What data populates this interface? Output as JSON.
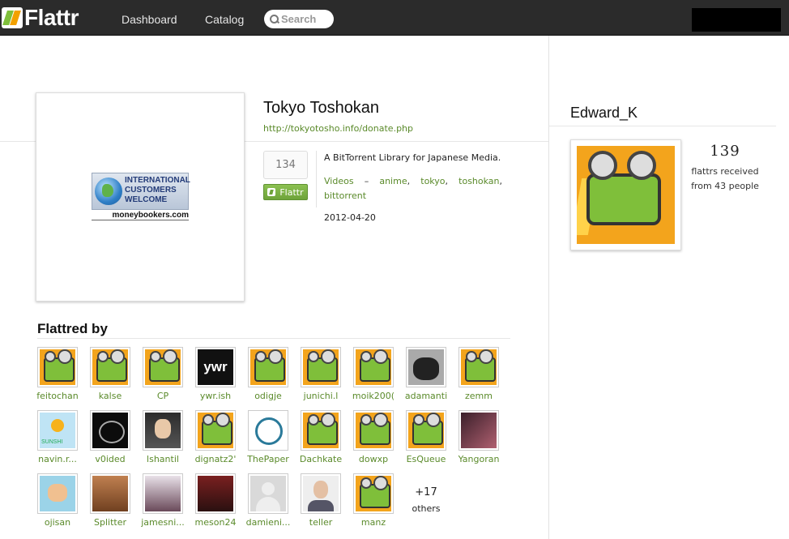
{
  "header": {
    "logo_text": "Flattr",
    "nav": {
      "dashboard": "Dashboard",
      "catalog": "Catalog"
    },
    "search_placeholder": "Search"
  },
  "thing": {
    "title": "Tokyo Toshokan",
    "url": "http://tokyotosho.info/donate.php",
    "flattr_count": "134",
    "flattr_button": "Flattr",
    "description": "A BitTorrent Library for Japanese Media.",
    "category": "Videos",
    "tag_separator": "–",
    "tags": [
      "anime",
      "tokyo",
      "toshokan",
      "bittorrent"
    ],
    "date": "2012-04-20",
    "image": {
      "banner_lines": [
        "INTERNATIONAL",
        "CUSTOMERS",
        "WELCOME"
      ],
      "domain": "moneybookers.com"
    }
  },
  "flattred_by": {
    "heading": "Flattred by",
    "users": [
      {
        "name": "feitochan",
        "avatar": "projector"
      },
      {
        "name": "kalse",
        "avatar": "projector"
      },
      {
        "name": "CP",
        "avatar": "projector"
      },
      {
        "name": "ywr.ish",
        "avatar": "dark",
        "avatar_text": "ywr"
      },
      {
        "name": "odigje",
        "avatar": "projector"
      },
      {
        "name": "junichi.l",
        "avatar": "projector"
      },
      {
        "name": "moik200(",
        "avatar": "projector"
      },
      {
        "name": "adamanti",
        "avatar": "adam"
      },
      {
        "name": "zemm",
        "avatar": "projector"
      },
      {
        "name": "navin.r...",
        "avatar": "sun"
      },
      {
        "name": "v0ided",
        "avatar": "v0"
      },
      {
        "name": "lshantil",
        "avatar": "portrait2"
      },
      {
        "name": "dignatz2'",
        "avatar": "projector"
      },
      {
        "name": "ThePaper",
        "avatar": "logo"
      },
      {
        "name": "Dachkate",
        "avatar": "projector"
      },
      {
        "name": "dowxp",
        "avatar": "projector"
      },
      {
        "name": "EsQueue",
        "avatar": "projector"
      },
      {
        "name": "Yangoran",
        "avatar": "purple"
      },
      {
        "name": "ojisan",
        "avatar": "cartoon"
      },
      {
        "name": "Splitter",
        "avatar": "eye"
      },
      {
        "name": "jamesni...",
        "avatar": "anime"
      },
      {
        "name": "meson24",
        "avatar": "meson"
      },
      {
        "name": "damieni...",
        "avatar": "gray"
      },
      {
        "name": "teller",
        "avatar": "teller"
      },
      {
        "name": "manz",
        "avatar": "projector"
      }
    ],
    "others_count": "+17",
    "others_label": "others"
  },
  "owner": {
    "name": "Edward_K",
    "flattrs": "139",
    "flattrs_label": "flattrs received",
    "from_label": "from 43 people"
  },
  "colors": {
    "topbar": "#2b2b2b",
    "link_green": "#5a8a2a",
    "button_green": "#7fbf3a",
    "logo_orange": "#f2a100"
  }
}
